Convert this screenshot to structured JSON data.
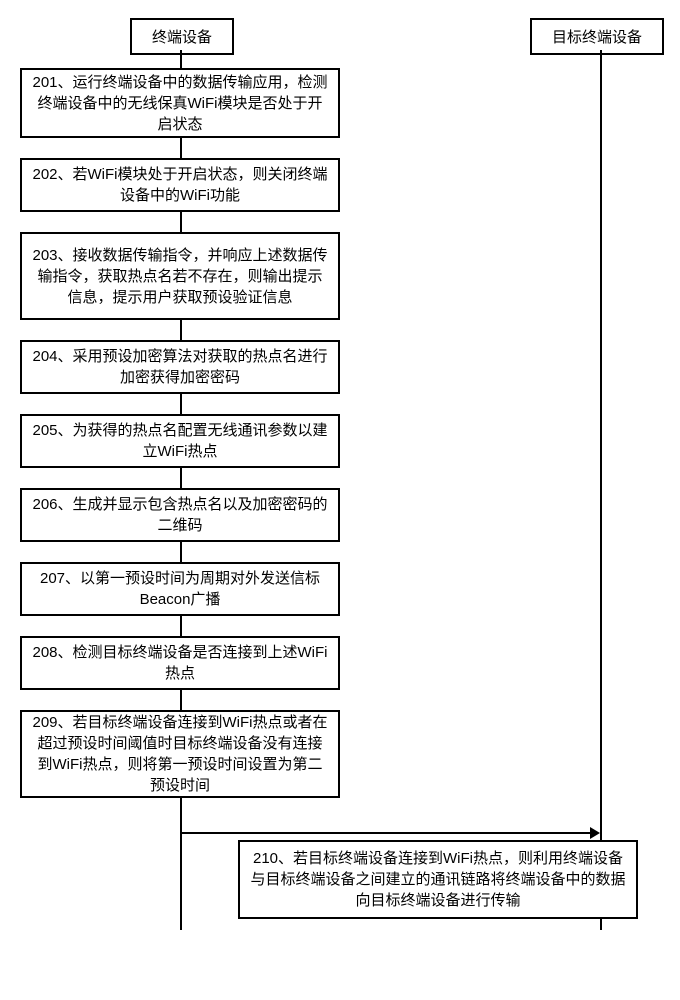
{
  "headers": {
    "left": "终端设备",
    "right": "目标终端设备"
  },
  "steps": {
    "s201": "201、运行终端设备中的数据传输应用，检测终端设备中的无线保真WiFi模块是否处于开启状态",
    "s202": "202、若WiFi模块处于开启状态，则关闭终端设备中的WiFi功能",
    "s203": "203、接收数据传输指令，并响应上述数据传输指令，获取热点名若不存在，则输出提示信息，提示用户获取预设验证信息",
    "s204": "204、采用预设加密算法对获取的热点名进行加密获得加密密码",
    "s205": "205、为获得的热点名配置无线通讯参数以建立WiFi热点",
    "s206": "206、生成并显示包含热点名以及加密密码的二维码",
    "s207": "207、以第一预设时间为周期对外发送信标Beacon广播",
    "s208": "208、检测目标终端设备是否连接到上述WiFi热点",
    "s209": "209、若目标终端设备连接到WiFi热点或者在超过预设时间阈值时目标终端设备没有连接到WiFi热点，则将第一预设时间设置为第二预设时间",
    "s210": "210、若目标终端设备连接到WiFi热点，则利用终端设备与目标终端设备之间建立的通讯链路将终端设备中的数据向目标终端设备进行传输"
  }
}
